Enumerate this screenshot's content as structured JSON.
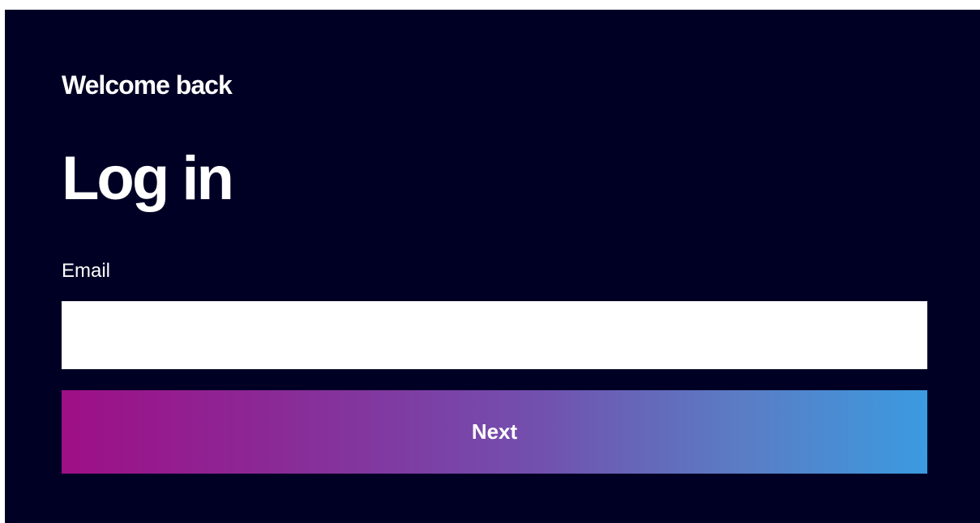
{
  "login": {
    "subtitle": "Welcome back",
    "title": "Log in",
    "email_label": "Email",
    "email_value": "",
    "email_placeholder": "",
    "next_label": "Next"
  },
  "colors": {
    "background": "#000025",
    "input_background": "#ffffff",
    "button_gradient_start": "#9e0f86",
    "button_gradient_end": "#3b9ae0",
    "text": "#ffffff"
  }
}
